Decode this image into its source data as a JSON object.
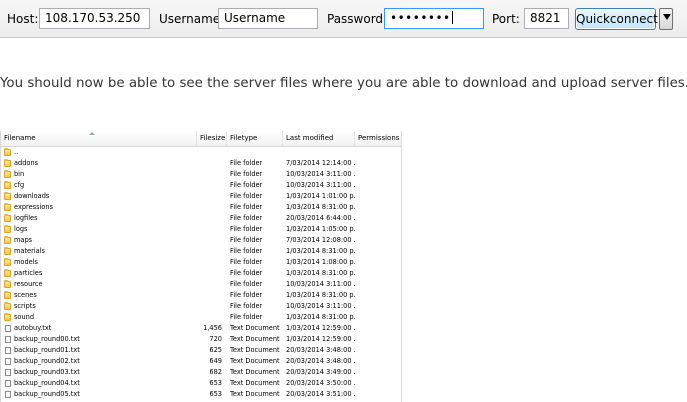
{
  "quickconnect": {
    "host_label": "Host:",
    "host_value": "108.170.53.250",
    "username_label": "Username:",
    "username_value": "Username",
    "password_label": "Password:",
    "password_value": "••••••••",
    "port_label": "Port:",
    "port_value": "8821",
    "button_label": "Quickconnect"
  },
  "instruction": "You should now be able to see the server files where you are able to download and upload server files.",
  "file_list": {
    "columns": [
      "Filename",
      "Filesize",
      "Filetype",
      "Last modified",
      "Permissions"
    ],
    "rows": [
      {
        "name": "..",
        "size": "",
        "type": "",
        "modified": "",
        "icon": "folder-icon"
      },
      {
        "name": "addons",
        "size": "",
        "type": "File folder",
        "modified": "7/03/2014 12:14:00 ...",
        "icon": "folder-icon"
      },
      {
        "name": "bin",
        "size": "",
        "type": "File folder",
        "modified": "10/03/2014 3:11:00 ...",
        "icon": "folder-icon"
      },
      {
        "name": "cfg",
        "size": "",
        "type": "File folder",
        "modified": "10/03/2014 3:11:00 ...",
        "icon": "folder-icon"
      },
      {
        "name": "downloads",
        "size": "",
        "type": "File folder",
        "modified": "1/03/2014 1:01:00 p...",
        "icon": "folder-icon"
      },
      {
        "name": "expressions",
        "size": "",
        "type": "File folder",
        "modified": "1/03/2014 8:31:00 p...",
        "icon": "folder-icon"
      },
      {
        "name": "logfiles",
        "size": "",
        "type": "File folder",
        "modified": "20/03/2014 6:44:00 ...",
        "icon": "folder-icon"
      },
      {
        "name": "logs",
        "size": "",
        "type": "File folder",
        "modified": "1/03/2014 1:05:00 p...",
        "icon": "folder-icon"
      },
      {
        "name": "maps",
        "size": "",
        "type": "File folder",
        "modified": "7/03/2014 12:08:00 ...",
        "icon": "folder-icon"
      },
      {
        "name": "materials",
        "size": "",
        "type": "File folder",
        "modified": "1/03/2014 8:31:00 p...",
        "icon": "folder-icon"
      },
      {
        "name": "models",
        "size": "",
        "type": "File folder",
        "modified": "1/03/2014 1:08:00 p...",
        "icon": "folder-icon"
      },
      {
        "name": "particles",
        "size": "",
        "type": "File folder",
        "modified": "1/03/2014 8:31:00 p...",
        "icon": "folder-icon"
      },
      {
        "name": "resource",
        "size": "",
        "type": "File folder",
        "modified": "10/03/2014 3:11:00 ...",
        "icon": "folder-icon"
      },
      {
        "name": "scenes",
        "size": "",
        "type": "File folder",
        "modified": "1/03/2014 8:31:00 p...",
        "icon": "folder-icon"
      },
      {
        "name": "scripts",
        "size": "",
        "type": "File folder",
        "modified": "10/03/2014 3:11:00 ...",
        "icon": "folder-icon"
      },
      {
        "name": "sound",
        "size": "",
        "type": "File folder",
        "modified": "1/03/2014 8:31:00 p...",
        "icon": "folder-icon"
      },
      {
        "name": "autobuy.txt",
        "size": "1,456",
        "type": "Text Document",
        "modified": "1/03/2014 12:59:00 ...",
        "icon": "text-document-icon"
      },
      {
        "name": "backup_round00.txt",
        "size": "720",
        "type": "Text Document",
        "modified": "1/03/2014 12:59:00 ...",
        "icon": "text-document-icon"
      },
      {
        "name": "backup_round01.txt",
        "size": "625",
        "type": "Text Document",
        "modified": "20/03/2014 3:48:00 ...",
        "icon": "text-document-icon"
      },
      {
        "name": "backup_round02.txt",
        "size": "649",
        "type": "Text Document",
        "modified": "20/03/2014 3:48:00 ...",
        "icon": "text-document-icon"
      },
      {
        "name": "backup_round03.txt",
        "size": "682",
        "type": "Text Document",
        "modified": "20/03/2014 3:49:00 ...",
        "icon": "text-document-icon"
      },
      {
        "name": "backup_round04.txt",
        "size": "653",
        "type": "Text Document",
        "modified": "20/03/2014 3:50:00 ...",
        "icon": "text-document-icon"
      },
      {
        "name": "backup_round05.txt",
        "size": "653",
        "type": "Text Document",
        "modified": "20/03/2014 3:51:00 ...",
        "icon": "text-document-icon"
      }
    ]
  }
}
